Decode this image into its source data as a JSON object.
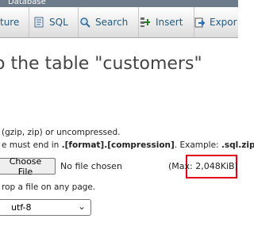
{
  "breadcrumb": {
    "text": "Database"
  },
  "tabs": [
    {
      "label": "ture",
      "icon": "structure-icon"
    },
    {
      "label": "SQL",
      "icon": "sql-icon"
    },
    {
      "label": "Search",
      "icon": "search-icon"
    },
    {
      "label": "Insert",
      "icon": "insert-icon"
    },
    {
      "label": "Expor",
      "icon": "export-icon"
    }
  ],
  "page": {
    "heading": "o the table \"customers\""
  },
  "file_section": {
    "compression_text": "(gzip, zip) or uncompressed.",
    "name_rule_prefix": "e must end in ",
    "name_rule_bold": ".[format].[compression]",
    "name_rule_example_prefix": ". Example: ",
    "name_rule_example": ".sql.zip",
    "choose_label": "Choose File",
    "no_file_text": "No file chosen",
    "max_size": "(Max: 2,048KiB)",
    "drop_hint": "rop a file on any page."
  },
  "charset": {
    "selected": "utf-8"
  },
  "colors": {
    "link": "#235a81",
    "highlight": "#e3001b",
    "breadcrumb_bg": "#6e7b8b"
  }
}
